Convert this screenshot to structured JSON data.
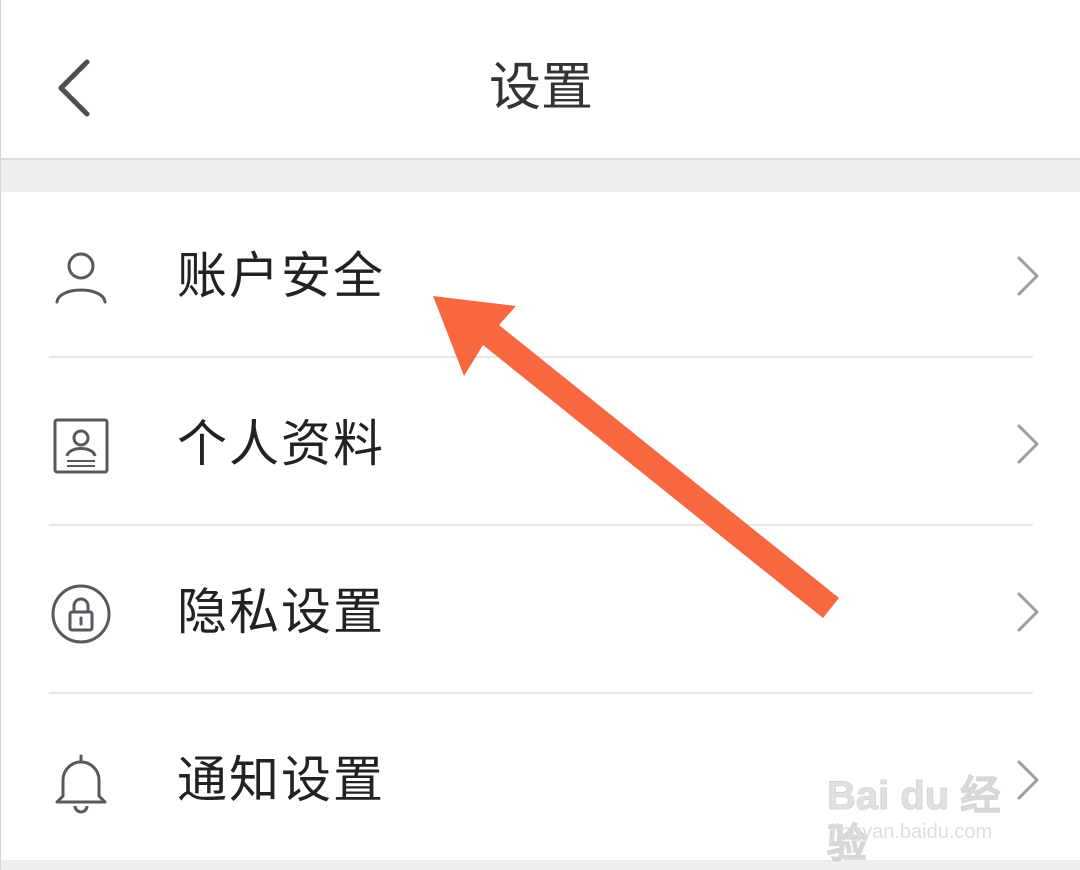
{
  "header": {
    "title": "设置",
    "back_icon": "chevron-left-icon"
  },
  "settings_list": [
    {
      "label": "账户安全",
      "icon": "user-icon"
    },
    {
      "label": "个人资料",
      "icon": "id-card-icon"
    },
    {
      "label": "隐私设置",
      "icon": "lock-icon"
    },
    {
      "label": "通知设置",
      "icon": "bell-icon"
    }
  ],
  "annotation": {
    "type": "arrow",
    "color": "#F76840",
    "points_to": "账户安全"
  },
  "watermark": {
    "brand": "Bai du 经验",
    "url": "jingyan.baidu.com"
  },
  "colors": {
    "text": "#222222",
    "icon": "#555a60",
    "divider": "#e6e6e6",
    "section_gap": "#eeeeee"
  }
}
